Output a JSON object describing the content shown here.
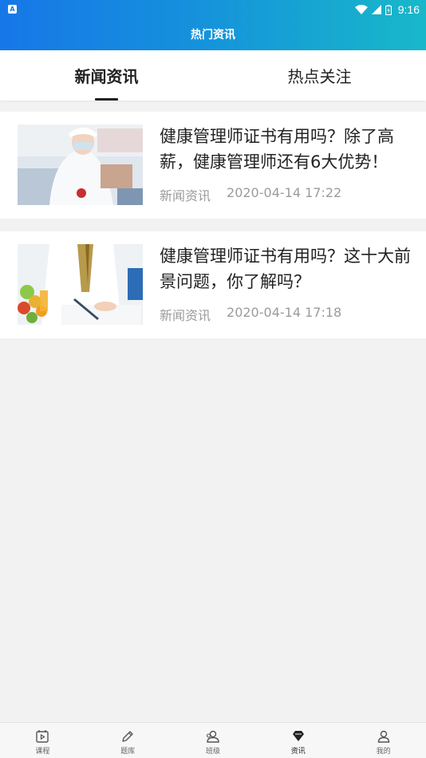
{
  "status_bar": {
    "time": "9:16",
    "app_icon_letter": "A"
  },
  "header": {
    "title": "热门资讯"
  },
  "tabs": [
    {
      "label": "新闻资讯",
      "active": true
    },
    {
      "label": "热点关注",
      "active": false
    }
  ],
  "articles": [
    {
      "title": "健康管理师证书有用吗？除了高薪，健康管理师还有6大优势！",
      "category": "新闻资讯",
      "datetime": "2020-04-14 17:22",
      "thumb_icon": "nurse-photo"
    },
    {
      "title": "健康管理师证书有用吗？这十大前景问题，你了解吗？",
      "category": "新闻资讯",
      "datetime": "2020-04-14 17:18",
      "thumb_icon": "doctor-writing-photo"
    }
  ],
  "bottom_nav": [
    {
      "label": "课程",
      "icon": "course-icon",
      "active": false
    },
    {
      "label": "题库",
      "icon": "pencil-icon",
      "active": false
    },
    {
      "label": "班级",
      "icon": "class-icon",
      "active": false
    },
    {
      "label": "资讯",
      "icon": "diamond-icon",
      "active": true
    },
    {
      "label": "我的",
      "icon": "person-icon",
      "active": false
    }
  ],
  "colors": {
    "header_gradient_start": "#1677e8",
    "header_gradient_end": "#18b8c9",
    "background": "#f2f2f2",
    "meta_text": "#9b9b9b"
  }
}
